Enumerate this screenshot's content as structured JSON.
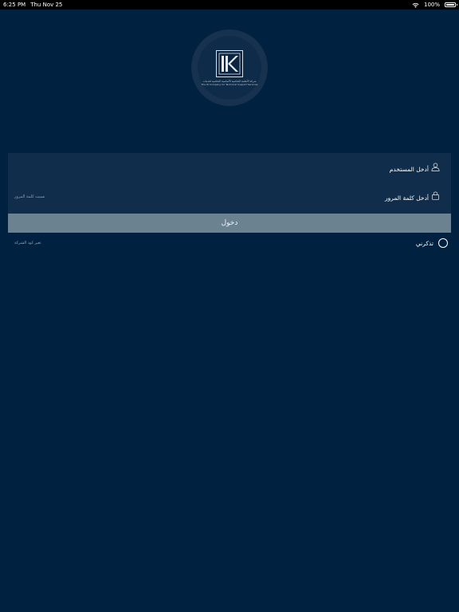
{
  "status_bar": {
    "time": "6:25 PM",
    "date": "Thu Nov 25",
    "battery": "100%"
  },
  "logo": {
    "arabic_name": "شركة الأنظمة التحكمية الأساسية التحكمية لخدمات",
    "english_name": "The IK Company for Technical Support Services",
    "icon": "ik-logo-icon"
  },
  "form": {
    "username_label": "أدخل المستخدم",
    "password_label": "أدخل كلمة المرور",
    "forgot_password": "نسيت كلمة المرور",
    "username_icon": "user-icon",
    "password_icon": "lock-icon"
  },
  "login_button": "دخول",
  "remember_me": "تذكرني",
  "change_company_code": "تغير كود الشركة",
  "colors": {
    "background": "#00213f",
    "panel": "#102d4c",
    "button": "#6b8290"
  }
}
